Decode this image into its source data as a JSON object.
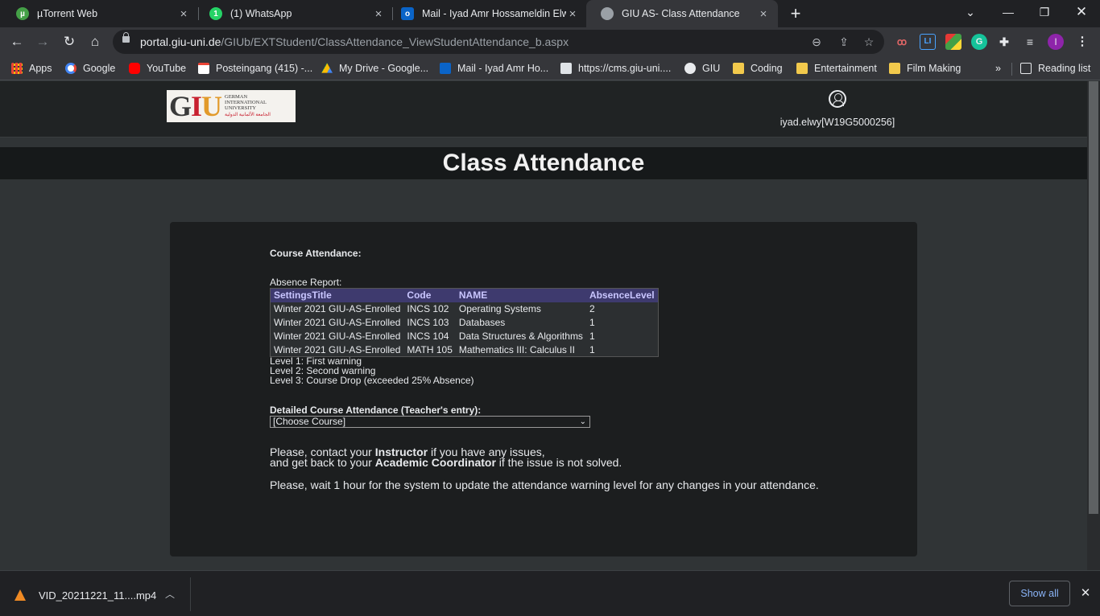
{
  "browser": {
    "tabs": [
      {
        "label": "µTorrent Web",
        "icon_color": "#44a047"
      },
      {
        "label": "(1) WhatsApp",
        "icon_color": "#25d366"
      },
      {
        "label": "Mail - Iyad Amr Hossameldin Elw",
        "icon_color": "#0a64c8"
      },
      {
        "label": "GIU AS- Class Attendance",
        "icon_color": "#9aa0a6"
      }
    ],
    "tab_close": "×",
    "new_tab": "+",
    "url_host": "portal.giu-uni.de",
    "url_path": "/GIUb/EXTStudent/ClassAttendance_ViewStudentAttendance_b.aspx",
    "extensions": [
      "LI",
      "G",
      "I"
    ],
    "bookmarks": [
      {
        "label": "Apps"
      },
      {
        "label": "Google"
      },
      {
        "label": "YouTube"
      },
      {
        "label": "Posteingang (415) -..."
      },
      {
        "label": "My Drive - Google..."
      },
      {
        "label": "Mail - Iyad Amr Ho..."
      },
      {
        "label": "https://cms.giu-uni...."
      },
      {
        "label": "GIU"
      },
      {
        "label": "Coding"
      },
      {
        "label": "Entertainment"
      },
      {
        "label": "Film Making"
      }
    ],
    "bookmarks_overflow": "»",
    "reading_list": "Reading list"
  },
  "header": {
    "logo_text": "GERMAN INTERNATIONAL UNIVERSITY",
    "logo_arabic": "الجامعة الألمانية الدولية",
    "username": "iyad.elwy[W19G5000256]"
  },
  "page": {
    "title": "Class Attendance",
    "course_attendance_label": "Course Attendance:",
    "absence_report_label": "Absence Report:",
    "table": {
      "headers": [
        "SettingsTitle",
        "Code",
        "NAME",
        "AbsenceLevel"
      ],
      "rows": [
        [
          "Winter 2021 GIU-AS-Enrolled",
          "INCS 102",
          "Operating Systems",
          "2"
        ],
        [
          "Winter 2021 GIU-AS-Enrolled",
          "INCS 103",
          "Databases",
          "1"
        ],
        [
          "Winter 2021 GIU-AS-Enrolled",
          "INCS 104",
          "Data Structures & Algorithms",
          "1"
        ],
        [
          "Winter 2021 GIU-AS-Enrolled",
          "MATH 105",
          "Mathematics III: Calculus II",
          "1"
        ]
      ]
    },
    "levels": [
      "Level 1: First warning",
      "Level 2: Second warning",
      "Level 3: Course Drop (exceeded 25% Absence)"
    ],
    "detailed_label": "Detailed Course Attendance (Teacher's entry):",
    "course_select_value": "[Choose Course]",
    "contact_1a": "Please, contact your ",
    "contact_1b": "Instructor",
    "contact_1c": " if you have any issues,",
    "contact_2a": "and get back to your ",
    "contact_2b": "Academic Coordinator",
    "contact_2c": " if the issue is not solved.",
    "wait_note": "Please, wait 1 hour for the system to update the attendance warning level for any changes in your attendance."
  },
  "downloads": {
    "file": "VID_20211221_11....mp4",
    "show_all": "Show all"
  }
}
